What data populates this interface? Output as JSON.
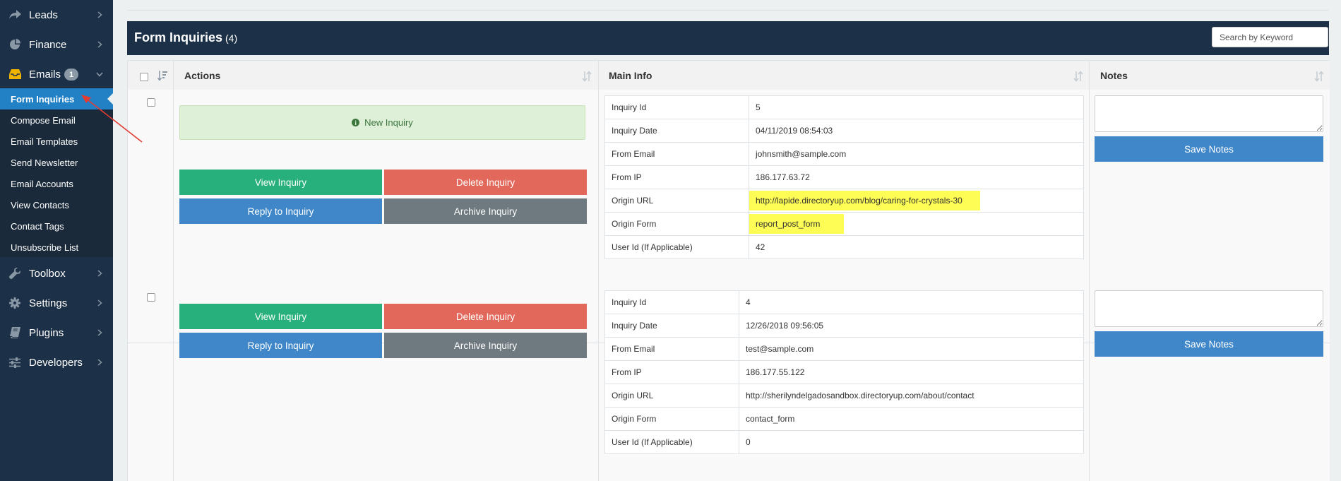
{
  "sidebar": {
    "items_top": [
      {
        "label": "Leads",
        "icon": "share-arrow-icon"
      },
      {
        "label": "Finance",
        "icon": "pie-chart-icon"
      },
      {
        "label": "Emails",
        "icon": "inbox-icon",
        "badge": "1"
      }
    ],
    "submenu": [
      {
        "label": "Form Inquiries",
        "active": true
      },
      {
        "label": "Compose Email"
      },
      {
        "label": "Email Templates"
      },
      {
        "label": "Send Newsletter"
      },
      {
        "label": "Email Accounts"
      },
      {
        "label": "View Contacts"
      },
      {
        "label": "Contact Tags"
      },
      {
        "label": "Unsubscribe List"
      }
    ],
    "items_bottom": [
      {
        "label": "Toolbox",
        "icon": "wrench-icon"
      },
      {
        "label": "Settings",
        "icon": "gear-icon"
      },
      {
        "label": "Plugins",
        "icon": "book-icon"
      },
      {
        "label": "Developers",
        "icon": "sliders-icon"
      }
    ]
  },
  "panel": {
    "title": "Form Inquiries",
    "count": "(4)",
    "search_placeholder": "Search by Keyword"
  },
  "table": {
    "columns": {
      "actions": "Actions",
      "main_info": "Main Info",
      "notes": "Notes"
    }
  },
  "rows": [
    {
      "status": "New Inquiry",
      "buttons": {
        "view": "View Inquiry",
        "delete": "Delete Inquiry",
        "reply": "Reply to Inquiry",
        "archive": "Archive Inquiry"
      },
      "info": [
        {
          "label": "Inquiry Id",
          "value": "5"
        },
        {
          "label": "Inquiry Date",
          "value": "04/11/2019 08:54:03"
        },
        {
          "label": "From Email",
          "value": "johnsmith@sample.com"
        },
        {
          "label": "From IP",
          "value": "186.177.63.72"
        },
        {
          "label": "Origin URL",
          "value": "http://lapide.directoryup.com/blog/caring-for-crystals-30"
        },
        {
          "label": "Origin Form",
          "value": "report_post_form"
        },
        {
          "label": "User Id (If Applicable)",
          "value": "42"
        }
      ],
      "save_label": "Save Notes"
    },
    {
      "status": "",
      "buttons": {
        "view": "View Inquiry",
        "delete": "Delete Inquiry",
        "reply": "Reply to Inquiry",
        "archive": "Archive Inquiry"
      },
      "info": [
        {
          "label": "Inquiry Id",
          "value": "4"
        },
        {
          "label": "Inquiry Date",
          "value": "12/26/2018 09:56:05"
        },
        {
          "label": "From Email",
          "value": "test@sample.com"
        },
        {
          "label": "From IP",
          "value": "186.177.55.122"
        },
        {
          "label": "Origin URL",
          "value": "http://sherilyndelgadosandbox.directoryup.com/about/contact"
        },
        {
          "label": "Origin Form",
          "value": "contact_form"
        },
        {
          "label": "User Id (If Applicable)",
          "value": "0"
        }
      ],
      "save_label": "Save Notes"
    }
  ],
  "colors": {
    "sidebar_bg": "#1c3147",
    "active_item": "#2280c5",
    "highlight": "#fdfd55",
    "annotation_arrow": "#e03c31"
  }
}
